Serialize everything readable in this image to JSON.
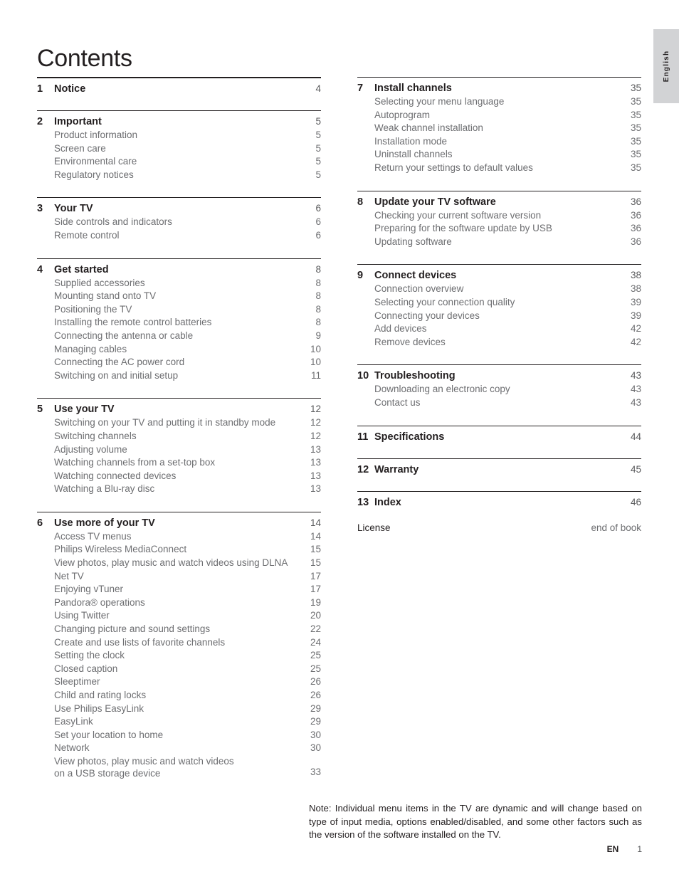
{
  "page_title": "Contents",
  "side_tab": {
    "label": "English"
  },
  "left_column": [
    {
      "rule": "thick",
      "number": "1",
      "title": "Notice",
      "page": "4",
      "entries": []
    },
    {
      "rule": "thin",
      "number": "2",
      "title": "Important",
      "page": "5",
      "entries": [
        {
          "title": "Product information",
          "page": "5"
        },
        {
          "title": "Screen care",
          "page": "5"
        },
        {
          "title": "Environmental care",
          "page": "5"
        },
        {
          "title": "Regulatory notices",
          "page": "5"
        }
      ]
    },
    {
      "rule": "thin",
      "number": "3",
      "title": "Your TV",
      "page": "6",
      "entries": [
        {
          "title": "Side controls and indicators",
          "page": "6"
        },
        {
          "title": "Remote control",
          "page": "6"
        }
      ]
    },
    {
      "rule": "thin",
      "number": "4",
      "title": "Get started",
      "page": "8",
      "entries": [
        {
          "title": "Supplied accessories",
          "page": "8"
        },
        {
          "title": "Mounting stand onto TV",
          "page": "8"
        },
        {
          "title": "Positioning the TV",
          "page": "8"
        },
        {
          "title": "Installing the remote control batteries",
          "page": "8"
        },
        {
          "title": "Connecting the antenna or cable",
          "page": "9"
        },
        {
          "title": "Managing cables",
          "page": "10"
        },
        {
          "title": "Connecting the AC power cord",
          "page": "10"
        },
        {
          "title": "Switching on and initial setup",
          "page": "11"
        }
      ]
    },
    {
      "rule": "thin",
      "number": "5",
      "title": "Use your TV",
      "page": "12",
      "entries": [
        {
          "title": "Switching on your TV and putting it in standby mode",
          "page": "12"
        },
        {
          "title": "Switching channels",
          "page": "12"
        },
        {
          "title": "Adjusting volume",
          "page": "13"
        },
        {
          "title": "Watching channels from a set-top box",
          "page": "13"
        },
        {
          "title": "Watching connected devices",
          "page": "13"
        },
        {
          "title": "Watching a Blu-ray disc",
          "page": "13"
        }
      ]
    },
    {
      "rule": "thin",
      "number": "6",
      "title": "Use more of your TV",
      "page": "14",
      "entries": [
        {
          "title": "Access TV menus",
          "page": "14"
        },
        {
          "title": "Philips Wireless MediaConnect",
          "page": "15"
        },
        {
          "title": "View photos, play music and watch videos using DLNA",
          "page": "15"
        },
        {
          "title": "Net TV",
          "page": "17"
        },
        {
          "title": "Enjoying vTuner",
          "page": "17"
        },
        {
          "title": "Pandora® operations",
          "page": "19"
        },
        {
          "title": "Using Twitter",
          "page": "20"
        },
        {
          "title": "Changing picture and sound settings",
          "page": "22"
        },
        {
          "title": "Create and use lists of favorite channels",
          "page": "24"
        },
        {
          "title": "Setting the clock",
          "page": "25"
        },
        {
          "title": "Closed caption",
          "page": "25"
        },
        {
          "title": "Sleeptimer",
          "page": "26"
        },
        {
          "title": "Child and rating locks",
          "page": "26"
        },
        {
          "title": "Use Philips EasyLink",
          "page": "29"
        },
        {
          "title": "EasyLink",
          "page": "29"
        },
        {
          "title": "Set your location to home",
          "page": "30"
        },
        {
          "title": "Network",
          "page": "30"
        },
        {
          "title": "View photos, play music and watch videos\non a USB storage device",
          "page": "33",
          "two_line": true
        }
      ]
    }
  ],
  "right_column": [
    {
      "rule": "thin",
      "number": "7",
      "title": "Install channels",
      "page": "35",
      "entries": [
        {
          "title": "Selecting your menu language",
          "page": "35"
        },
        {
          "title": "Autoprogram",
          "page": "35"
        },
        {
          "title": "Weak channel installation",
          "page": "35"
        },
        {
          "title": "Installation mode",
          "page": "35"
        },
        {
          "title": "Uninstall channels",
          "page": "35"
        },
        {
          "title": "Return your settings to default values",
          "page": "35"
        }
      ]
    },
    {
      "rule": "thin",
      "number": "8",
      "title": "Update your TV software",
      "page": "36",
      "entries": [
        {
          "title": "Checking your current software version",
          "page": "36"
        },
        {
          "title": "Preparing for the software update by USB",
          "page": "36"
        },
        {
          "title": "Updating software",
          "page": "36"
        }
      ]
    },
    {
      "rule": "thin",
      "number": "9",
      "title": "Connect devices",
      "page": "38",
      "entries": [
        {
          "title": "Connection overview",
          "page": "38"
        },
        {
          "title": "Selecting your connection quality",
          "page": "39"
        },
        {
          "title": "Connecting your devices",
          "page": "39"
        },
        {
          "title": "Add devices",
          "page": "42"
        },
        {
          "title": "Remove devices",
          "page": "42"
        }
      ]
    },
    {
      "rule": "thin",
      "number": "10",
      "title": "Troubleshooting",
      "page": "43",
      "entries": [
        {
          "title": "Downloading an electronic copy",
          "page": "43"
        },
        {
          "title": "Contact us",
          "page": "43"
        }
      ]
    },
    {
      "rule": "thin",
      "number": "11",
      "title": "Specifications",
      "page": "44",
      "entries": []
    },
    {
      "rule": "thin",
      "number": "12",
      "title": "Warranty",
      "page": "45",
      "entries": []
    },
    {
      "rule": "thin",
      "number": "13",
      "title": "Index",
      "page": "46",
      "entries": []
    }
  ],
  "license": {
    "label": "License",
    "value": "end of book"
  },
  "note": "Note: Individual menu items in the TV are dynamic and will change based on type of input media, options enabled/disabled, and some other factors such as the version of the software installed on the TV.",
  "footer": {
    "language": "EN",
    "page": "1"
  }
}
